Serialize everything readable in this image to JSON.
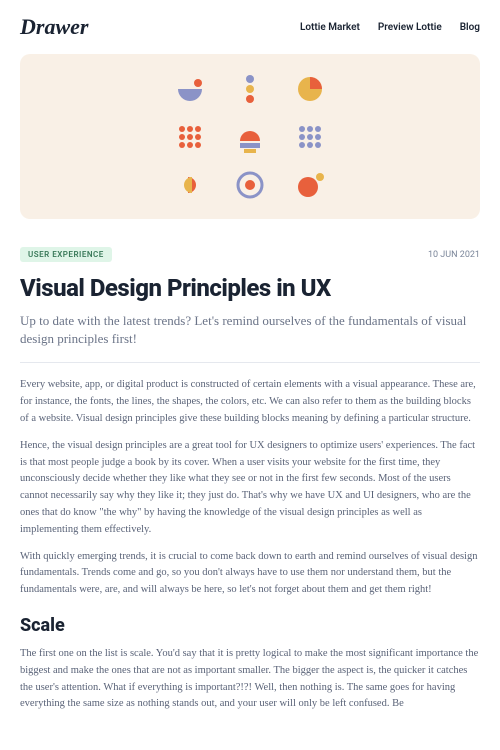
{
  "header": {
    "logo": "Drawer",
    "nav": [
      "Lottie Market",
      "Preview Lottie",
      "Blog"
    ]
  },
  "article": {
    "tag": "USER EXPERIENCE",
    "date": "10 JUN 2021",
    "title": "Visual Design Principles in UX",
    "subtitle": "Up to date with the latest trends? Let's remind ourselves of the fundamentals of visual design principles first!",
    "paragraphs": [
      "Every website, app, or digital product is constructed of certain elements with a visual appearance. These are, for instance, the fonts, the lines, the shapes, the colors, etc. We can also refer to them as the building blocks of a website. Visual design principles give these building blocks meaning by defining a particular structure.",
      "Hence, the visual design principles are a great tool for UX designers to optimize users' experiences. The fact is that most people judge a book by its cover. When a user visits your website for the first time, they unconsciously decide whether they like what they see or not in the first few seconds. Most of the users cannot necessarily say why they like it; they just do. That's why we have UX and UI designers, who are the ones that do know \"the why\" by having the knowledge of the visual design principles as well as implementing them effectively.",
      "With quickly emerging trends, it is crucial to come back down to earth and remind ourselves of visual design fundamentals. Trends come and go, so you don't always have to use them nor understand them, but the fundamentals were, are, and will always be here, so let's not forget about them and get them right!"
    ],
    "section_heading": "Scale",
    "section_text": "The first one on the list is scale. You'd say that it is pretty logical to make the most significant importance the biggest and make the ones that are not as important smaller. The bigger the aspect is, the quicker it catches the user's attention. What if everything is important?!?! Well, then nothing is. The same goes for having everything the same size as nothing stands out, and your user will only be left confused. Be"
  },
  "colors": {
    "orange": "#e8603c",
    "purple": "#8b93c7",
    "yellow": "#e8b44c"
  }
}
